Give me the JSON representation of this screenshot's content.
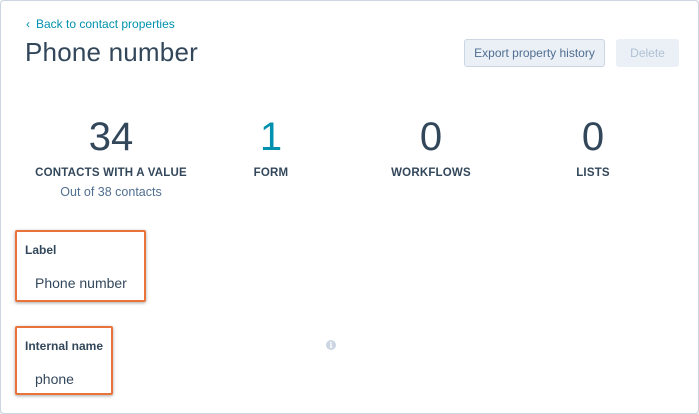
{
  "header": {
    "back_link_label": "Back to contact properties",
    "title": "Phone number",
    "export_button_label": "Export property history",
    "delete_button_label": "Delete"
  },
  "stats": [
    {
      "value": "34",
      "label": "CONTACTS WITH A VALUE",
      "sub": "Out of 38 contacts"
    },
    {
      "value": "1",
      "label": "FORM"
    },
    {
      "value": "0",
      "label": "WORKFLOWS"
    },
    {
      "value": "0",
      "label": "LISTS"
    }
  ],
  "fields": {
    "label": {
      "title": "Label",
      "value": "Phone number"
    },
    "internal_name": {
      "title": "Internal name",
      "value": "phone"
    }
  },
  "icons": {
    "back": "chevron-left-icon",
    "info": "info-icon"
  },
  "colors": {
    "link": "#0091ae",
    "text": "#33475b",
    "highlight": "#e8743b"
  }
}
